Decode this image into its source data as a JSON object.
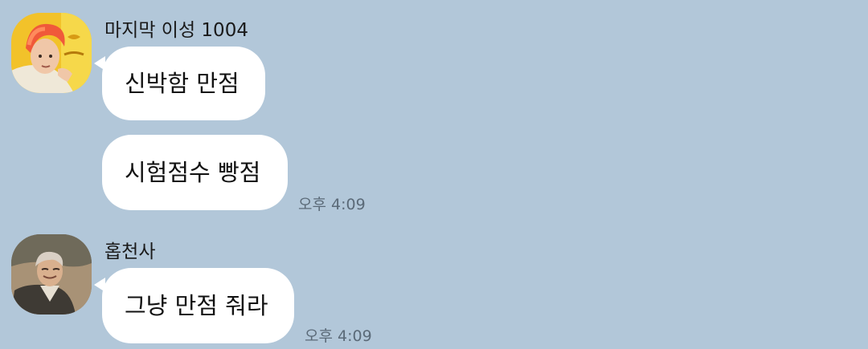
{
  "messages": [
    {
      "sender": "마지막 이성 1004",
      "bubbles": [
        "신박함 만점",
        "시험점수 빵점"
      ],
      "time": "오후 4:09"
    },
    {
      "sender": "홉천사",
      "bubbles": [
        "그냥 만점 줘라"
      ],
      "time": "오후 4:09"
    }
  ],
  "colors": {
    "background": "#b2c7d9",
    "bubble": "#ffffff",
    "timestamp": "#5b6a78"
  }
}
